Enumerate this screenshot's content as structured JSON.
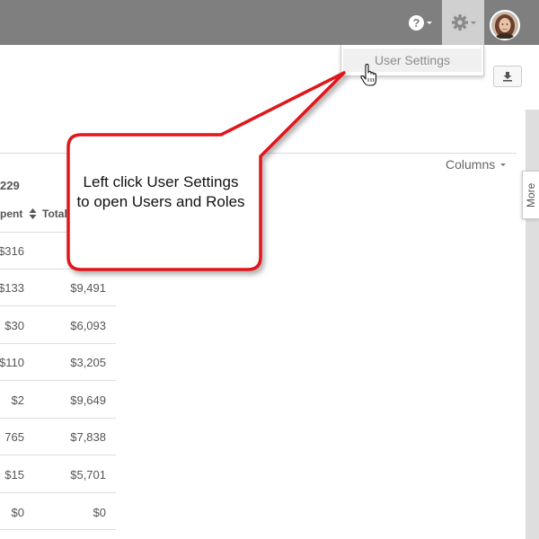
{
  "topbar": {
    "help_icon": "question-circle-icon",
    "settings_icon": "gear-icon",
    "avatar": "user-avatar"
  },
  "dropdown": {
    "user_settings_label": "User Settings"
  },
  "toolbar": {
    "download_icon": "download-icon",
    "columns_label": "Columns"
  },
  "more_tab_label": "More",
  "table": {
    "count_label": "229",
    "headers": {
      "spent": "pent",
      "total": "Total"
    },
    "rows": [
      {
        "spent": "$316",
        "total": ""
      },
      {
        "spent": "$133",
        "total": "$9,491"
      },
      {
        "spent": "$30",
        "total": "$6,093"
      },
      {
        "spent": "$110",
        "total": "$3,205"
      },
      {
        "spent": "$2",
        "total": "$9,649"
      },
      {
        "spent": "765",
        "total": "$7,838"
      },
      {
        "spent": "$15",
        "total": "$5,701"
      },
      {
        "spent": "$0",
        "total": "$0"
      }
    ]
  },
  "callout": {
    "text": "Left click User Settings to open Users and Roles",
    "border_color": "#e0141b"
  }
}
